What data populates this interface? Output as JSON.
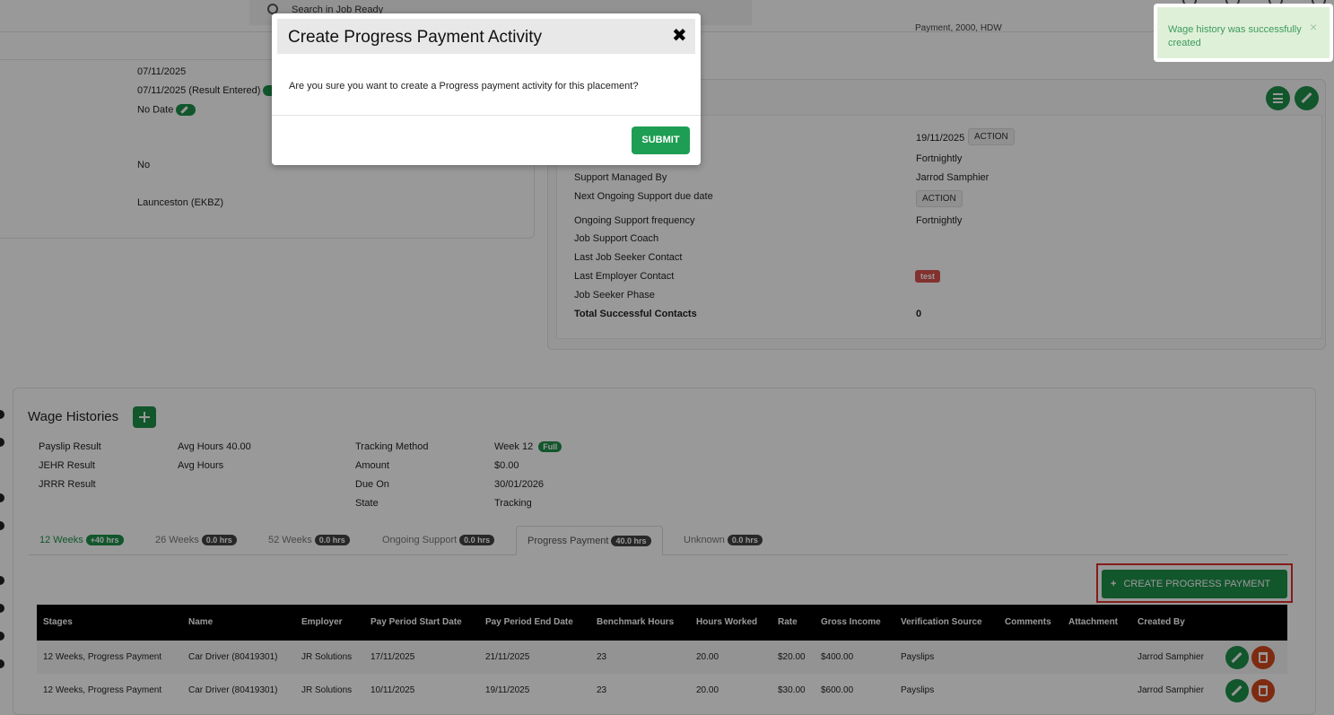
{
  "topbar": {
    "search_placeholder": "Search in Job Ready",
    "partial_text": "Payment, 2000, HDW"
  },
  "left_panel": {
    "date1": "07/11/2025",
    "date2": "07/11/2025 (Result Entered)",
    "no_date": "No Date",
    "no": "No",
    "location": "Launceston (EKBZ)"
  },
  "right_panel": {
    "rows": [
      {
        "label": "",
        "value": "19/11/2025"
      },
      {
        "label": "",
        "value": "Fortnightly"
      },
      {
        "label": "Support Managed By",
        "value": "Jarrod Samphier"
      },
      {
        "label": "Next Ongoing Support due date",
        "value": ""
      },
      {
        "label": "Ongoing Support frequency",
        "value": "Fortnightly"
      },
      {
        "label": "Job Support Coach",
        "value": ""
      },
      {
        "label": "Last Job Seeker Contact",
        "value": ""
      },
      {
        "label": "Last Employer Contact",
        "value": ""
      },
      {
        "label": "Job Seeker Phase",
        "value": ""
      },
      {
        "label": "Total Successful Contacts",
        "value": "0"
      }
    ],
    "action_label": "ACTION",
    "test_tag": "test"
  },
  "wage": {
    "title": "Wage Histories",
    "left_labels": [
      "Payslip Result",
      "JEHR Result",
      "JRRR Result"
    ],
    "left_values": [
      "Avg Hours 40.00",
      "Avg Hours",
      ""
    ],
    "right_labels": [
      "Tracking Method",
      "Amount",
      "Due On",
      "State"
    ],
    "right_values": [
      "Week 12",
      "$0.00",
      "30/01/2026",
      "Tracking"
    ],
    "full_badge": "Full"
  },
  "tabs": [
    {
      "label": "12 Weeks",
      "pill": "+40 hrs"
    },
    {
      "label": "26 Weeks",
      "pill": "0.0 hrs"
    },
    {
      "label": "52 Weeks",
      "pill": "0.0 hrs"
    },
    {
      "label": "Ongoing Support",
      "pill": "0.0 hrs"
    },
    {
      "label": "Progress Payment",
      "pill": "40.0 hrs"
    },
    {
      "label": "Unknown",
      "pill": "0.0 hrs"
    }
  ],
  "create_button": "CREATE PROGRESS PAYMENT",
  "table": {
    "headers": [
      "Stages",
      "Name",
      "Employer",
      "Pay Period Start Date",
      "Pay Period End Date",
      "Benchmark Hours",
      "Hours Worked",
      "Rate",
      "Gross Income",
      "Verification Source",
      "Comments",
      "Attachment",
      "Created By"
    ],
    "rows": [
      [
        "12 Weeks, Progress Payment",
        "Car Driver (80419301)",
        "JR Solutions",
        "17/11/2025",
        "21/11/2025",
        "23",
        "20.00",
        "$20.00",
        "$400.00",
        "Payslips",
        "",
        "",
        "Jarrod Samphier"
      ],
      [
        "12 Weeks, Progress Payment",
        "Car Driver (80419301)",
        "JR Solutions",
        "10/11/2025",
        "19/11/2025",
        "23",
        "20.00",
        "$30.00",
        "$600.00",
        "Payslips",
        "",
        "",
        "Jarrod Samphier"
      ]
    ]
  },
  "toast": {
    "message": "Wage history was successfully created",
    "close": "×"
  },
  "modal": {
    "title": "Create Progress Payment Activity",
    "close": "✖",
    "body": "Are you sure you want to create a Progress payment activity for this placement?",
    "submit": "SUBMIT"
  }
}
